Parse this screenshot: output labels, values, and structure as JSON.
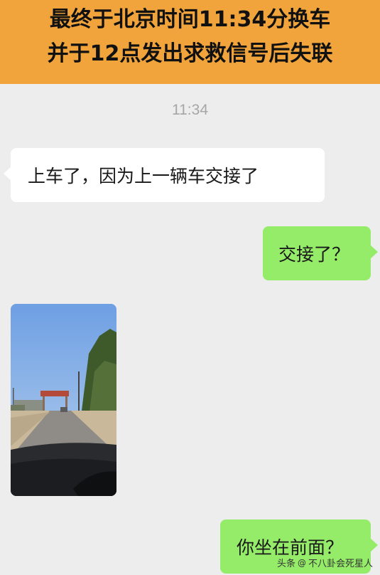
{
  "banner": {
    "line1": "最终于北京时间11:34分换车",
    "line2": "并于12点发出求救信号后失联"
  },
  "chat": {
    "timestamp": "11:34",
    "messages": [
      {
        "side": "left",
        "text": "上车了，因为上一辆车交接了"
      },
      {
        "side": "right",
        "text": "交接了？"
      },
      {
        "side": "left",
        "type": "image",
        "description": "road-photo"
      },
      {
        "side": "right",
        "text": "你坐在前面？"
      }
    ]
  },
  "watermark": {
    "prefix": "头条",
    "at": "@",
    "account": "不八卦会死星人"
  },
  "colors": {
    "banner_bg": "#f0a43b",
    "chat_bg": "#ededed",
    "outgoing_bubble": "#95ec69",
    "incoming_bubble": "#ffffff"
  }
}
